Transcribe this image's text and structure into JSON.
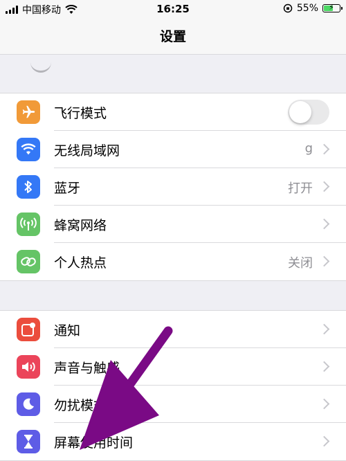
{
  "status_bar": {
    "carrier": "中国移动",
    "time": "16:25",
    "battery_percent": "55%",
    "battery_level": 0.55,
    "charging": true
  },
  "nav": {
    "title": "设置"
  },
  "colors": {
    "airplane": "#f19a38",
    "wifi": "#3478f6",
    "bluetooth": "#3478f6",
    "cellular": "#65c466",
    "hotspot": "#65c466",
    "notifications": "#eb4d3d",
    "sounds": "#eb445a",
    "dnd": "#5e5ce6",
    "screentime": "#5e5ce6",
    "annotation_arrow": "#7a0a85"
  },
  "group1": [
    {
      "label": "飞行模式",
      "icon": "airplane-icon",
      "control": "toggle",
      "toggle_on": false
    },
    {
      "label": "无线局域网",
      "icon": "wifi-icon",
      "value": "g"
    },
    {
      "label": "蓝牙",
      "icon": "bluetooth-icon",
      "value": "打开"
    },
    {
      "label": "蜂窝网络",
      "icon": "cellular-antenna-icon",
      "value": ""
    },
    {
      "label": "个人热点",
      "icon": "hotspot-link-icon",
      "value": "关闭"
    }
  ],
  "group2": [
    {
      "label": "通知",
      "icon": "notification-badge-icon"
    },
    {
      "label": "声音与触感",
      "icon": "speaker-icon"
    },
    {
      "label": "勿扰模式",
      "icon": "moon-icon"
    },
    {
      "label": "屏幕使用时间",
      "icon": "hourglass-icon"
    }
  ]
}
